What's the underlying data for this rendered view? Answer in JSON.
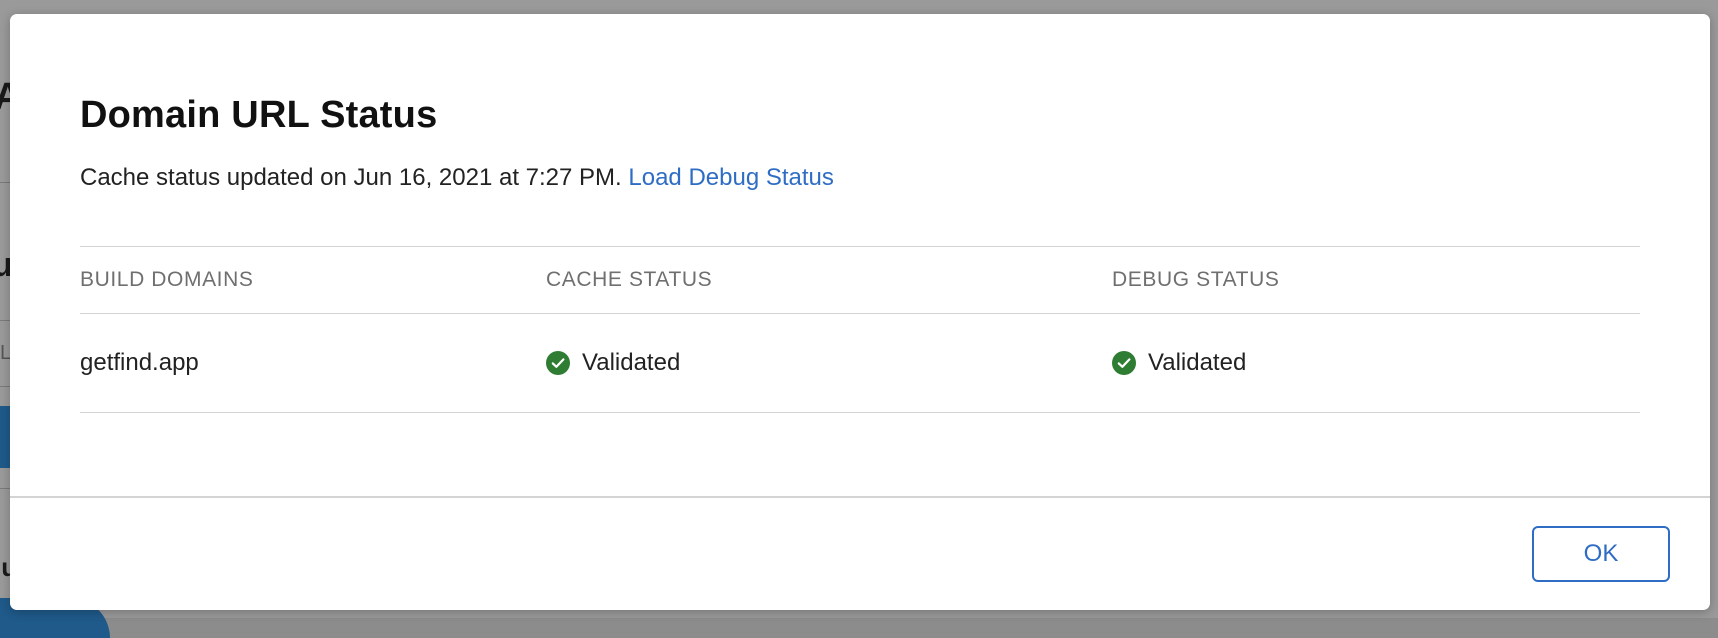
{
  "background": {
    "fragments": [
      "A",
      "u",
      "L",
      "lu"
    ]
  },
  "modal": {
    "title": "Domain URL Status",
    "cache_text": "Cache status updated on Jun 16, 2021 at 7:27 PM.",
    "debug_link": "Load Debug Status",
    "table": {
      "headers": [
        "BUILD DOMAINS",
        "CACHE STATUS",
        "DEBUG STATUS"
      ],
      "rows": [
        {
          "domain": "getfind.app",
          "cache_status": "Validated",
          "debug_status": "Validated"
        }
      ]
    },
    "ok_label": "OK"
  },
  "icons": {
    "status_ok": "check-circle-icon"
  },
  "colors": {
    "accent": "#2f6dc4",
    "success": "#2e7d32"
  }
}
